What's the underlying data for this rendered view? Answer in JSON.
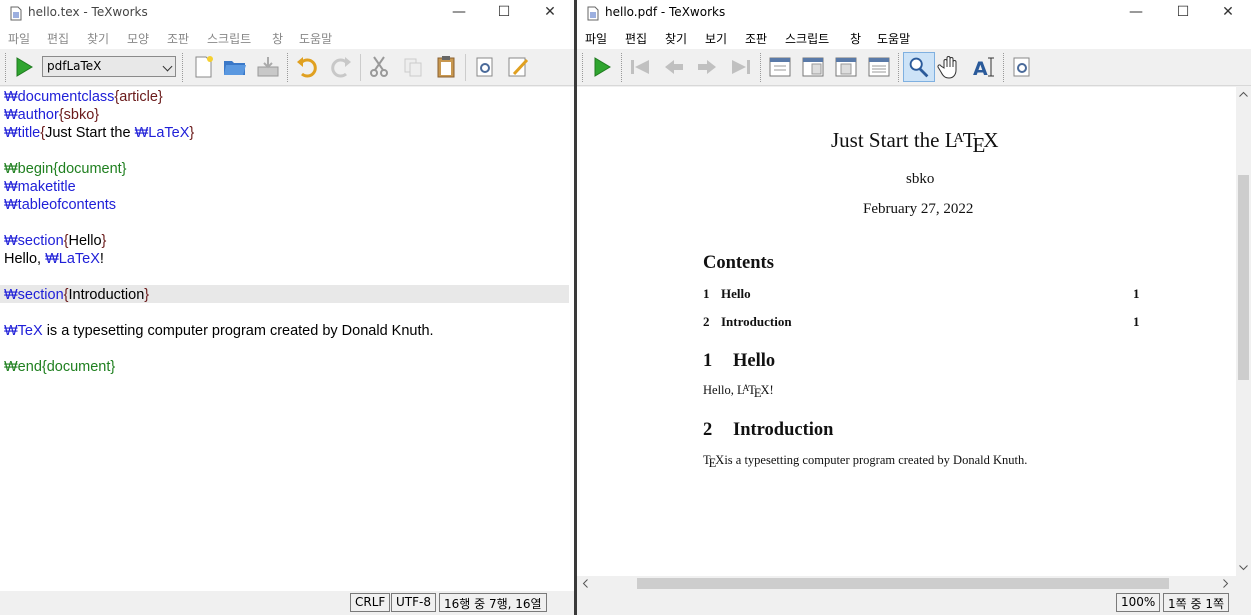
{
  "src": {
    "title": "hello.tex - TeXworks",
    "menu": [
      "파일",
      "편집",
      "찾기",
      "모양",
      "조판",
      "스크립트",
      "창",
      "도움말"
    ],
    "engine": "pdfLaTeX",
    "lines": [
      [
        {
          "t": "₩documentclass",
          "c": "cmd"
        },
        {
          "t": "{article}",
          "c": "arg"
        }
      ],
      [
        {
          "t": "₩author",
          "c": "cmd"
        },
        {
          "t": "{sbko}",
          "c": "arg"
        }
      ],
      [
        {
          "t": "₩title",
          "c": "cmd"
        },
        {
          "t": "{",
          "c": "arg"
        },
        {
          "t": "Just Start the ",
          "c": ""
        },
        {
          "t": "₩LaTeX",
          "c": "cmd"
        },
        {
          "t": "}",
          "c": "arg"
        }
      ],
      [],
      [
        {
          "t": "₩begin{document}",
          "c": "env"
        }
      ],
      [
        {
          "t": "₩maketitle",
          "c": "cmd"
        }
      ],
      [
        {
          "t": "₩tableofcontents",
          "c": "cmd"
        }
      ],
      [],
      [
        {
          "t": "₩section",
          "c": "cmd"
        },
        {
          "t": "{",
          "c": "arg"
        },
        {
          "t": "Hello",
          "c": ""
        },
        {
          "t": "}",
          "c": "arg"
        }
      ],
      [
        {
          "t": "Hello, ",
          "c": ""
        },
        {
          "t": "₩LaTeX",
          "c": "cmd"
        },
        {
          "t": "!",
          "c": ""
        }
      ],
      [],
      [
        {
          "t": "₩section",
          "c": "cmd"
        },
        {
          "t": "{",
          "c": "arg"
        },
        {
          "t": "Introduction",
          "c": ""
        },
        {
          "t": "}",
          "c": "arg"
        }
      ],
      [],
      [
        {
          "t": "₩TeX",
          "c": "cmd"
        },
        {
          "t": " is a typesetting computer program created by Donald Knuth.",
          "c": ""
        }
      ],
      [],
      [
        {
          "t": "₩end{document}",
          "c": "env"
        }
      ]
    ],
    "status": {
      "eol": "CRLF",
      "encoding": "UTF-8",
      "position": "16행 중 7행, 16열"
    }
  },
  "pdf": {
    "title": "hello.pdf - TeXworks",
    "menu": [
      "파일",
      "편집",
      "찾기",
      "보기",
      "조판",
      "스크립트",
      "창",
      "도움말"
    ],
    "doc_title_pre": "Just Start the ",
    "doc_title_L": "L",
    "doc_title_A": "A",
    "doc_title_T": "T",
    "doc_title_E": "E",
    "doc_title_X": "X",
    "author": "sbko",
    "date": "February 27, 2022",
    "contents": "Contents",
    "toc": [
      {
        "num": "1",
        "label": "Hello",
        "page": "1"
      },
      {
        "num": "2",
        "label": "Introduction",
        "page": "1"
      }
    ],
    "s1_num": "1",
    "s1_title": "Hello",
    "s1_body_pre": "Hello, ",
    "s1_body_L": "L",
    "s1_body_A": "A",
    "s1_body_T": "T",
    "s1_body_E": "E",
    "s1_body_X": "X",
    "s1_body_post": "!",
    "s2_num": "2",
    "s2_title": "Introduction",
    "s2_T": "T",
    "s2_E": "E",
    "s2_X": "X",
    "s2_body_post": "is a typesetting computer program created by Donald Knuth.",
    "status": {
      "zoom": "100%",
      "page": "1쪽 중 1쪽"
    }
  },
  "window_buttons": {
    "minimize": "—",
    "maximize": "☐",
    "close": "✕"
  }
}
